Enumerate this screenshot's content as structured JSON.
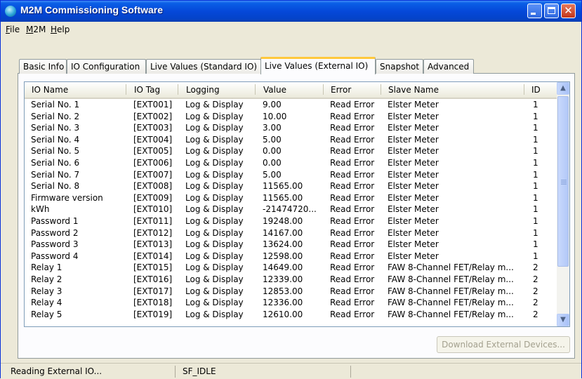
{
  "window": {
    "title": "M2M Commissioning Software"
  },
  "menu": [
    {
      "label": "File",
      "u": "F",
      "rest": "ile"
    },
    {
      "label": "M2M",
      "u": "M",
      "rest": "2M"
    },
    {
      "label": "Help",
      "u": "H",
      "rest": "elp"
    }
  ],
  "tabs": [
    "Basic Info",
    "IO Configuration",
    "Live Values (Standard IO)",
    "Live Values (External IO)",
    "Snapshot",
    "Advanced"
  ],
  "active_tab": "Live Values (External IO)",
  "table": {
    "columns": [
      "IO Name",
      "IO Tag",
      "Logging",
      "Value",
      "Error",
      "Slave Name",
      "ID"
    ],
    "rows": [
      [
        "Serial No. 1",
        "[EXT001]",
        "Log & Display",
        "9.00",
        "Read Error",
        "Elster Meter",
        "1"
      ],
      [
        "Serial No. 2",
        "[EXT002]",
        "Log & Display",
        "10.00",
        "Read Error",
        "Elster Meter",
        "1"
      ],
      [
        "Serial No. 3",
        "[EXT003]",
        "Log & Display",
        "3.00",
        "Read Error",
        "Elster Meter",
        "1"
      ],
      [
        "Serial No. 4",
        "[EXT004]",
        "Log & Display",
        "5.00",
        "Read Error",
        "Elster Meter",
        "1"
      ],
      [
        "Serial No. 5",
        "[EXT005]",
        "Log & Display",
        "0.00",
        "Read Error",
        "Elster Meter",
        "1"
      ],
      [
        "Serial No. 6",
        "[EXT006]",
        "Log & Display",
        "0.00",
        "Read Error",
        "Elster Meter",
        "1"
      ],
      [
        "Serial No. 7",
        "[EXT007]",
        "Log & Display",
        "5.00",
        "Read Error",
        "Elster Meter",
        "1"
      ],
      [
        "Serial No. 8",
        "[EXT008]",
        "Log & Display",
        "11565.00",
        "Read Error",
        "Elster Meter",
        "1"
      ],
      [
        "Firmware version",
        "[EXT009]",
        "Log & Display",
        "11565.00",
        "Read Error",
        "Elster Meter",
        "1"
      ],
      [
        "kWh",
        "[EXT010]",
        "Log & Display",
        "-21474720...",
        "Read Error",
        "Elster Meter",
        "1"
      ],
      [
        "Password 1",
        "[EXT011]",
        "Log & Display",
        "19248.00",
        "Read Error",
        "Elster Meter",
        "1"
      ],
      [
        "Password 2",
        "[EXT012]",
        "Log & Display",
        "14167.00",
        "Read Error",
        "Elster Meter",
        "1"
      ],
      [
        "Password 3",
        "[EXT013]",
        "Log & Display",
        "13624.00",
        "Read Error",
        "Elster Meter",
        "1"
      ],
      [
        "Password 4",
        "[EXT014]",
        "Log & Display",
        "12598.00",
        "Read Error",
        "Elster Meter",
        "1"
      ],
      [
        "Relay 1",
        "[EXT015]",
        "Log & Display",
        "14649.00",
        "Read Error",
        "FAW 8-Channel FET/Relay m...",
        "2"
      ],
      [
        "Relay 2",
        "[EXT016]",
        "Log & Display",
        "12339.00",
        "Read Error",
        "FAW 8-Channel FET/Relay m...",
        "2"
      ],
      [
        "Relay 3",
        "[EXT017]",
        "Log & Display",
        "12853.00",
        "Read Error",
        "FAW 8-Channel FET/Relay m...",
        "2"
      ],
      [
        "Relay 4",
        "[EXT018]",
        "Log & Display",
        "12336.00",
        "Read Error",
        "FAW 8-Channel FET/Relay m...",
        "2"
      ],
      [
        "Relay 5",
        "[EXT019]",
        "Log & Display",
        "12610.00",
        "Read Error",
        "FAW 8-Channel FET/Relay m...",
        "2"
      ]
    ]
  },
  "download_button": "Download External Devices...",
  "status": {
    "message": "Reading External IO...",
    "state": "SF_IDLE"
  },
  "icons": {
    "app": "m2m-app-icon",
    "minimize": "minimize-icon",
    "maximize": "maximize-icon",
    "close": "close-icon",
    "scroll_up": "scroll-up-arrow-icon",
    "scroll_down": "scroll-down-arrow-icon"
  },
  "colors": {
    "titlebar": "#0548d9",
    "active_tab_accent": "#ffc83c",
    "window_bg": "#ece9d8"
  }
}
